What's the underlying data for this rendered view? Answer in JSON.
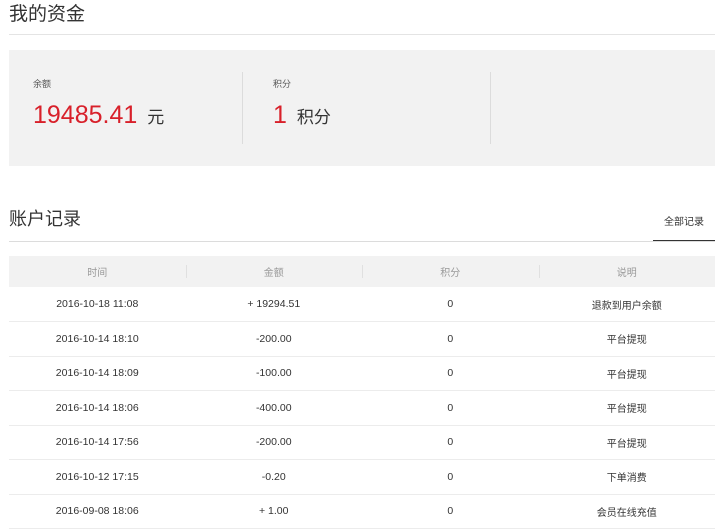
{
  "page_title": "我的资金",
  "funds": {
    "balance": {
      "label": "余额",
      "value": "19485.41",
      "unit": "元"
    },
    "points": {
      "label": "积分",
      "value": "1",
      "unit": "积分"
    }
  },
  "records_section": {
    "title": "账户记录",
    "tab_all_label": "全部记录",
    "columns": [
      "时间",
      "金额",
      "积分",
      "说明"
    ],
    "rows": [
      {
        "time": "2016-10-18 11:08",
        "amount": "+ 19294.51",
        "points": "0",
        "desc": "退款到用户余额"
      },
      {
        "time": "2016-10-14 18:10",
        "amount": "-200.00",
        "points": "0",
        "desc": "平台提现"
      },
      {
        "time": "2016-10-14 18:09",
        "amount": "-100.00",
        "points": "0",
        "desc": "平台提现"
      },
      {
        "time": "2016-10-14 18:06",
        "amount": "-400.00",
        "points": "0",
        "desc": "平台提现"
      },
      {
        "time": "2016-10-14 17:56",
        "amount": "-200.00",
        "points": "0",
        "desc": "平台提现"
      },
      {
        "time": "2016-10-12 17:15",
        "amount": "-0.20",
        "points": "0",
        "desc": "下单消费"
      },
      {
        "time": "2016-09-08 18:06",
        "amount": "+ 1.00",
        "points": "0",
        "desc": "会员在线充值"
      }
    ]
  },
  "colors": {
    "accent_red": "#d8202a",
    "panel_bg": "#f2f2f2"
  }
}
